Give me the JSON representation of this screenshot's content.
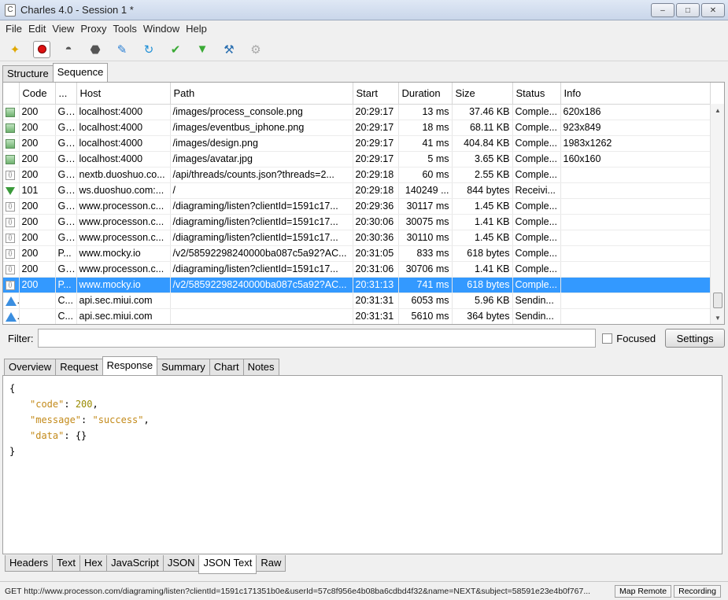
{
  "window": {
    "title": "Charles 4.0 - Session 1 *",
    "app_icon": "charles-icon"
  },
  "menu": [
    "File",
    "Edit",
    "View",
    "Proxy",
    "Tools",
    "Window",
    "Help"
  ],
  "toolbar": [
    "broom-icon",
    "record-icon",
    "turtle-icon",
    "stop-icon",
    "pen-icon",
    "refresh-icon",
    "check-icon",
    "basket-icon",
    "tools-icon",
    "gear-icon"
  ],
  "top_tabs": [
    "Structure",
    "Sequence"
  ],
  "table": {
    "columns": [
      "Code",
      "...",
      "Host",
      "Path",
      "Start",
      "Duration",
      "Size",
      "Status",
      "Info"
    ],
    "rows": [
      {
        "icon": "img",
        "code": "200",
        "m": "G...",
        "host": "localhost:4000",
        "path": "/images/process_console.png",
        "start": "20:29:17",
        "dur": "13 ms",
        "size": "37.46 KB",
        "status": "Comple...",
        "info": "620x186"
      },
      {
        "icon": "img",
        "code": "200",
        "m": "G...",
        "host": "localhost:4000",
        "path": "/images/eventbus_iphone.png",
        "start": "20:29:17",
        "dur": "18 ms",
        "size": "68.11 KB",
        "status": "Comple...",
        "info": "923x849"
      },
      {
        "icon": "img",
        "code": "200",
        "m": "G...",
        "host": "localhost:4000",
        "path": "/images/design.png",
        "start": "20:29:17",
        "dur": "41 ms",
        "size": "404.84 KB",
        "status": "Comple...",
        "info": "1983x1262"
      },
      {
        "icon": "img",
        "code": "200",
        "m": "G...",
        "host": "localhost:4000",
        "path": "/images/avatar.jpg",
        "start": "20:29:17",
        "dur": "5 ms",
        "size": "3.65 KB",
        "status": "Comple...",
        "info": "160x160"
      },
      {
        "icon": "json",
        "code": "200",
        "m": "G...",
        "host": "nextb.duoshuo.co...",
        "path": "/api/threads/counts.json?threads=2...",
        "start": "20:29:18",
        "dur": "60 ms",
        "size": "2.55 KB",
        "status": "Comple...",
        "info": ""
      },
      {
        "icon": "down",
        "code": "101",
        "m": "G...",
        "host": "ws.duoshuo.com:...",
        "path": "/",
        "start": "20:29:18",
        "dur": "140249 ...",
        "size": "844 bytes",
        "status": "Receivi...",
        "info": ""
      },
      {
        "icon": "json",
        "code": "200",
        "m": "G...",
        "host": "www.processon.c...",
        "path": "/diagraming/listen?clientId=1591c17...",
        "start": "20:29:36",
        "dur": "30117 ms",
        "size": "1.45 KB",
        "status": "Comple...",
        "info": ""
      },
      {
        "icon": "json",
        "code": "200",
        "m": "G...",
        "host": "www.processon.c...",
        "path": "/diagraming/listen?clientId=1591c17...",
        "start": "20:30:06",
        "dur": "30075 ms",
        "size": "1.41 KB",
        "status": "Comple...",
        "info": ""
      },
      {
        "icon": "json",
        "code": "200",
        "m": "G...",
        "host": "www.processon.c...",
        "path": "/diagraming/listen?clientId=1591c17...",
        "start": "20:30:36",
        "dur": "30110 ms",
        "size": "1.45 KB",
        "status": "Comple...",
        "info": ""
      },
      {
        "icon": "json",
        "code": "200",
        "m": "P...",
        "host": "www.mocky.io",
        "path": "/v2/58592298240000ba087c5a92?AC...",
        "start": "20:31:05",
        "dur": "833 ms",
        "size": "618 bytes",
        "status": "Comple...",
        "info": ""
      },
      {
        "icon": "json",
        "code": "200",
        "m": "G...",
        "host": "www.processon.c...",
        "path": "/diagraming/listen?clientId=1591c17...",
        "start": "20:31:06",
        "dur": "30706 ms",
        "size": "1.41 KB",
        "status": "Comple...",
        "info": ""
      },
      {
        "icon": "json",
        "code": "200",
        "m": "P...",
        "host": "www.mocky.io",
        "path": "/v2/58592298240000ba087c5a92?AC...",
        "start": "20:31:13",
        "dur": "741 ms",
        "size": "618 bytes",
        "status": "Comple...",
        "info": "",
        "selected": true
      },
      {
        "icon": "up",
        "code": "",
        "m": "C...",
        "host": "api.sec.miui.com",
        "path": "",
        "start": "20:31:31",
        "dur": "6053 ms",
        "size": "5.96 KB",
        "status": "Sendin...",
        "info": ""
      },
      {
        "icon": "up",
        "code": "",
        "m": "C...",
        "host": "api.sec.miui.com",
        "path": "",
        "start": "20:31:31",
        "dur": "5610 ms",
        "size": "364 bytes",
        "status": "Sendin...",
        "info": ""
      }
    ]
  },
  "filter": {
    "label": "Filter:",
    "value": "",
    "focused_label": "Focused",
    "settings_label": "Settings"
  },
  "detail_tabs": [
    "Overview",
    "Request",
    "Response",
    "Summary",
    "Chart",
    "Notes"
  ],
  "response_body": {
    "code_key": "\"code\"",
    "code_val": "200",
    "message_key": "\"message\"",
    "message_val": "\"success\"",
    "data_key": "\"data\"",
    "data_val": "{}"
  },
  "view_tabs": [
    "Headers",
    "Text",
    "Hex",
    "JavaScript",
    "JSON",
    "JSON Text",
    "Raw"
  ],
  "status": {
    "text": "GET http://www.processon.com/diagraming/listen?clientId=1591c171351b0e&userId=57c8f956e4b08ba6cdbd4f32&name=NEXT&subject=58591e23e4b0f767...",
    "map_remote": "Map Remote",
    "recording": "Recording"
  }
}
